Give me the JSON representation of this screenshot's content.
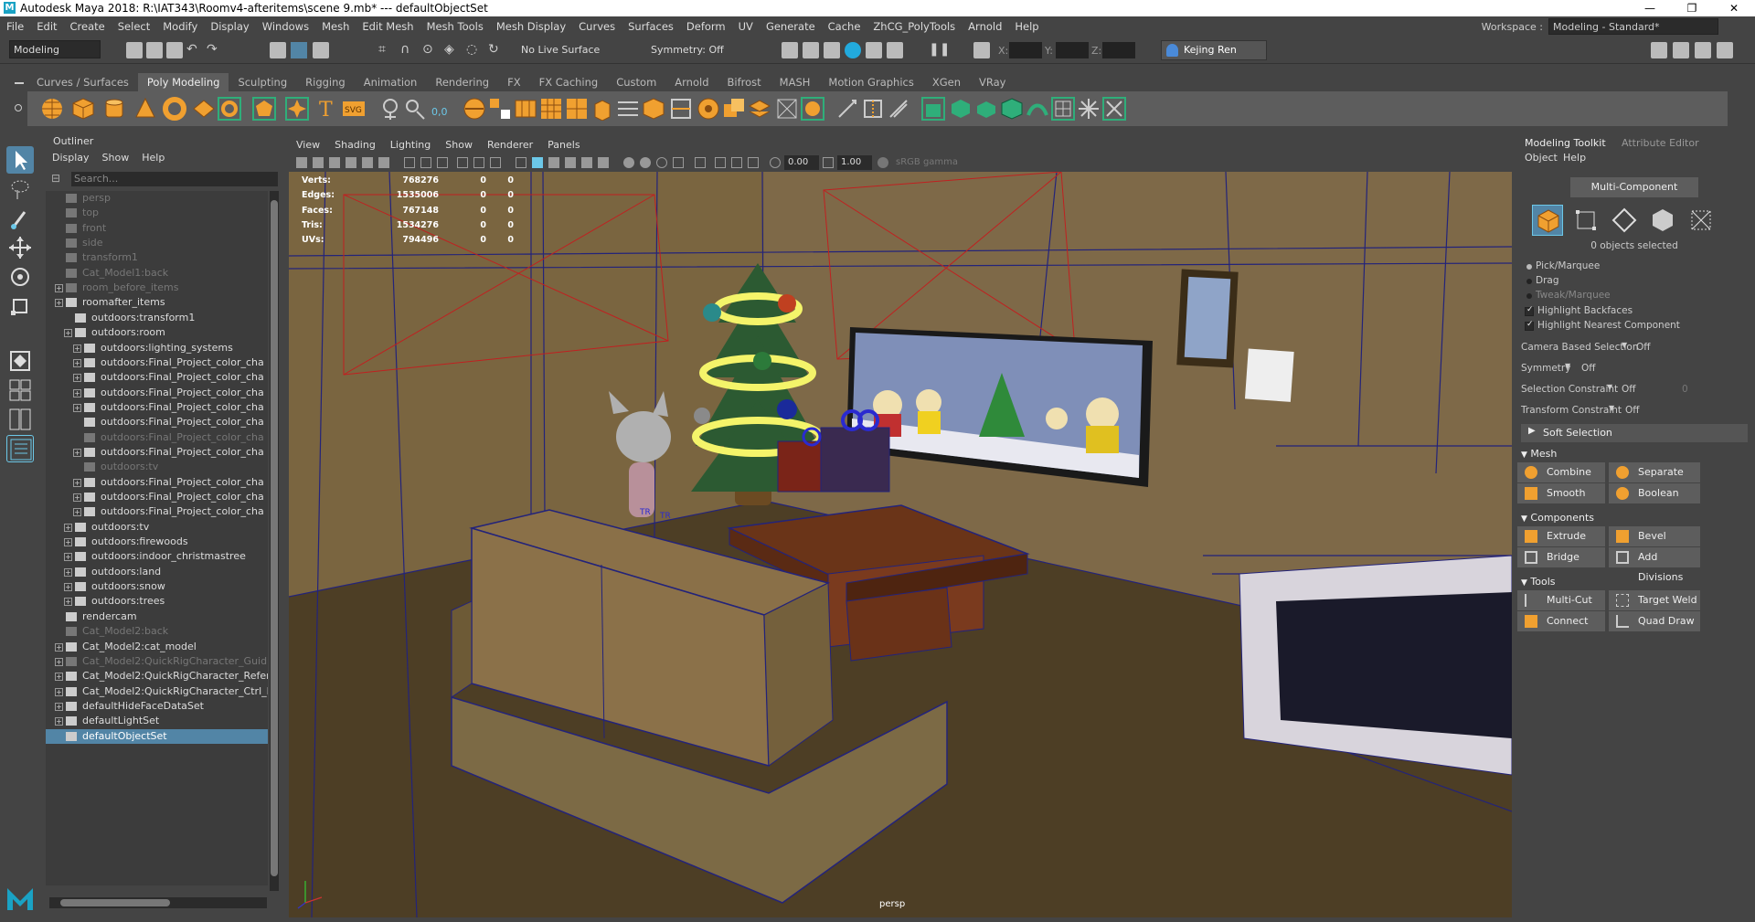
{
  "window": {
    "title": "Autodesk Maya 2018: R:\\IAT343\\Roomv4-afteritems\\scene 9.mb*  ---  defaultObjectSet",
    "controls": [
      "—",
      "❐",
      "✕"
    ]
  },
  "menubar": [
    "File",
    "Edit",
    "Create",
    "Select",
    "Modify",
    "Display",
    "Windows",
    "Mesh",
    "Edit Mesh",
    "Mesh Tools",
    "Mesh Display",
    "Curves",
    "Surfaces",
    "Deform",
    "UV",
    "Generate",
    "Cache",
    "ZhCG_PolyTools",
    "Arnold",
    "Help"
  ],
  "workspace": {
    "label": "Workspace :",
    "value": "Modeling - Standard*"
  },
  "statusline": {
    "mode": "Modeling",
    "live_surface": "No Live Surface",
    "symmetry": "Symmetry: Off",
    "x_label": "X:",
    "y_label": "Y:",
    "z_label": "Z:",
    "user": "Kejing Ren"
  },
  "shelf_tabs": [
    "Curves / Surfaces",
    "Poly Modeling",
    "Sculpting",
    "Rigging",
    "Animation",
    "Rendering",
    "FX",
    "FX Caching",
    "Custom",
    "Arnold",
    "Bifrost",
    "MASH",
    "Motion Graphics",
    "XGen",
    "VRay"
  ],
  "shelf_active": "Poly Modeling",
  "outliner": {
    "title": "Outliner",
    "menu": [
      "Display",
      "Show",
      "Help"
    ],
    "search_placeholder": "Search...",
    "rows": [
      {
        "label": "persp",
        "dim": true
      },
      {
        "label": "top",
        "dim": true
      },
      {
        "label": "front",
        "dim": true
      },
      {
        "label": "side",
        "dim": true
      },
      {
        "label": "transform1",
        "dim": true
      },
      {
        "label": "Cat_Model1:back",
        "dim": true
      },
      {
        "label": "room_before_items",
        "dim": true
      },
      {
        "label": "roomafter_items",
        "dim": false
      },
      {
        "label": "outdoors:transform1",
        "dim": false
      },
      {
        "label": "outdoors:room",
        "dim": false
      },
      {
        "label": "outdoors:lighting_systems",
        "dim": false
      },
      {
        "label": "outdoors:Final_Project_color_cha",
        "dim": false
      },
      {
        "label": "outdoors:Final_Project_color_cha",
        "dim": false
      },
      {
        "label": "outdoors:Final_Project_color_cha",
        "dim": false
      },
      {
        "label": "outdoors:Final_Project_color_cha",
        "dim": false
      },
      {
        "label": "outdoors:Final_Project_color_cha",
        "dim": false
      },
      {
        "label": "outdoors:Final_Project_color_cha",
        "dim": true
      },
      {
        "label": "outdoors:Final_Project_color_cha",
        "dim": false
      },
      {
        "label": "outdoors:tv",
        "dim": true
      },
      {
        "label": "outdoors:Final_Project_color_cha",
        "dim": false
      },
      {
        "label": "outdoors:Final_Project_color_cha",
        "dim": false
      },
      {
        "label": "outdoors:Final_Project_color_cha",
        "dim": false
      },
      {
        "label": "outdoors:tv",
        "dim": false
      },
      {
        "label": "outdoors:firewoods",
        "dim": false
      },
      {
        "label": "outdoors:indoor_christmastree",
        "dim": false
      },
      {
        "label": "outdoors:land",
        "dim": false
      },
      {
        "label": "outdoors:snow",
        "dim": false
      },
      {
        "label": "outdoors:trees",
        "dim": false
      },
      {
        "label": "rendercam",
        "dim": false
      },
      {
        "label": "Cat_Model2:back",
        "dim": true
      },
      {
        "label": "Cat_Model2:cat_model",
        "dim": false
      },
      {
        "label": "Cat_Model2:QuickRigCharacter_Guid",
        "dim": true
      },
      {
        "label": "Cat_Model2:QuickRigCharacter_Refer",
        "dim": false
      },
      {
        "label": "Cat_Model2:QuickRigCharacter_Ctrl_I",
        "dim": false
      },
      {
        "label": "defaultHideFaceDataSet",
        "dim": false
      },
      {
        "label": "defaultLightSet",
        "dim": false
      },
      {
        "label": "defaultObjectSet",
        "dim": false,
        "selected": true
      }
    ]
  },
  "viewport": {
    "menu": [
      "View",
      "Shading",
      "Lighting",
      "Show",
      "Renderer",
      "Panels"
    ],
    "exposure": "0.00",
    "gamma": "1.00",
    "color_space": "sRGB gamma",
    "camera": "persp",
    "hud": [
      {
        "label": "Verts:",
        "a": "768276",
        "b": "0",
        "c": "0"
      },
      {
        "label": "Edges:",
        "a": "1535006",
        "b": "0",
        "c": "0"
      },
      {
        "label": "Faces:",
        "a": "767148",
        "b": "0",
        "c": "0"
      },
      {
        "label": "Tris:",
        "a": "1534276",
        "b": "0",
        "c": "0"
      },
      {
        "label": "UVs:",
        "a": "794496",
        "b": "0",
        "c": "0"
      }
    ],
    "gizmo_labels": [
      "TR",
      "TR"
    ]
  },
  "toolkit": {
    "tabs": [
      "Modeling Toolkit",
      "Attribute Editor"
    ],
    "menu": [
      "Object",
      "Help"
    ],
    "multi_component": "Multi-Component",
    "selected_count": "0 objects selected",
    "pick_marquee": "Pick/Marquee",
    "drag": "Drag",
    "tweak_marquee": "Tweak/Marquee",
    "highlight_backfaces": "Highlight Backfaces",
    "highlight_nearest": "Highlight Nearest Component",
    "camera_based": {
      "label": "Camera Based Selection",
      "value": "Off"
    },
    "symmetry": {
      "label": "Symmetry",
      "value": "Off"
    },
    "sel_constraint": {
      "label": "Selection Constraint",
      "value": "Off",
      "num": "0"
    },
    "transform_constraint": {
      "label": "Transform Constraint",
      "value": "Off"
    },
    "soft_selection": "Soft Selection",
    "mesh_section": "Mesh",
    "combine": "Combine",
    "separate": "Separate",
    "smooth": "Smooth",
    "boolean": "Boolean",
    "components_section": "Components",
    "extrude": "Extrude",
    "bevel": "Bevel",
    "bridge": "Bridge",
    "add_divisions": "Add Divisions",
    "tools_section": "Tools",
    "multi_cut": "Multi-Cut",
    "target_weld": "Target Weld",
    "connect": "Connect",
    "quad_draw": "Quad Draw"
  },
  "colors": {
    "accent": "#5285a6",
    "shelf_bg": "#5d5d5d",
    "panel_bg": "#444444",
    "viewport_bg": "#6e5a36",
    "icon_orange": "#f0a030",
    "icon_green": "#2fae7a"
  }
}
